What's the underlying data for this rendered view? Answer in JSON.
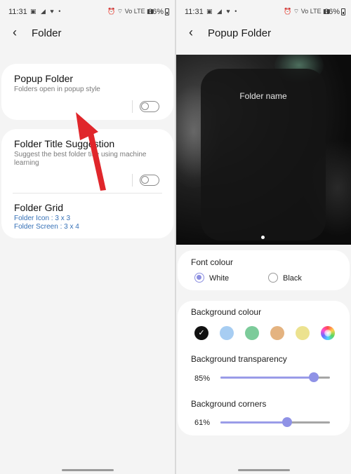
{
  "status": {
    "time": "11:31",
    "battery": "36%",
    "left_icons": "▣ ◢ ♥ •",
    "right_icons": "⏰ ⌔ Vo LTE ▮▮"
  },
  "left": {
    "header": {
      "title": "Folder"
    },
    "popup_folder": {
      "title": "Popup Folder",
      "subtitle": "Folders open in popup style",
      "enabled": false
    },
    "title_suggestion": {
      "title": "Folder Title Suggestion",
      "subtitle": "Suggest the best folder title using machine learning",
      "enabled": false
    },
    "folder_grid": {
      "title": "Folder Grid",
      "icon_line": "Folder Icon : 3 x 3",
      "screen_line": "Folder Screen : 3 x 4"
    },
    "annotation": {
      "arrow_color": "#e0262b"
    }
  },
  "right": {
    "header": {
      "title": "Popup Folder"
    },
    "preview": {
      "folder_name": "Folder name"
    },
    "font_colour": {
      "label": "Font colour",
      "options": [
        "White",
        "Black"
      ],
      "selected": "White"
    },
    "background_colour": {
      "label": "Background colour",
      "swatches": [
        {
          "name": "black",
          "color": "#111111",
          "selected": true
        },
        {
          "name": "light-blue",
          "color": "#a7cdf2",
          "selected": false
        },
        {
          "name": "green",
          "color": "#7ccb9a",
          "selected": false
        },
        {
          "name": "tan",
          "color": "#e4b380",
          "selected": false
        },
        {
          "name": "yellow",
          "color": "#ece28f",
          "selected": false
        },
        {
          "name": "custom",
          "color": "rainbow",
          "selected": false
        }
      ]
    },
    "background_transparency": {
      "label": "Background transparency",
      "value_text": "85%",
      "value": 0.85
    },
    "background_corners": {
      "label": "Background corners",
      "value_text": "61%",
      "value": 0.61
    }
  },
  "colors": {
    "accent": "#8c8fe0",
    "link_blue": "#3570b6"
  }
}
